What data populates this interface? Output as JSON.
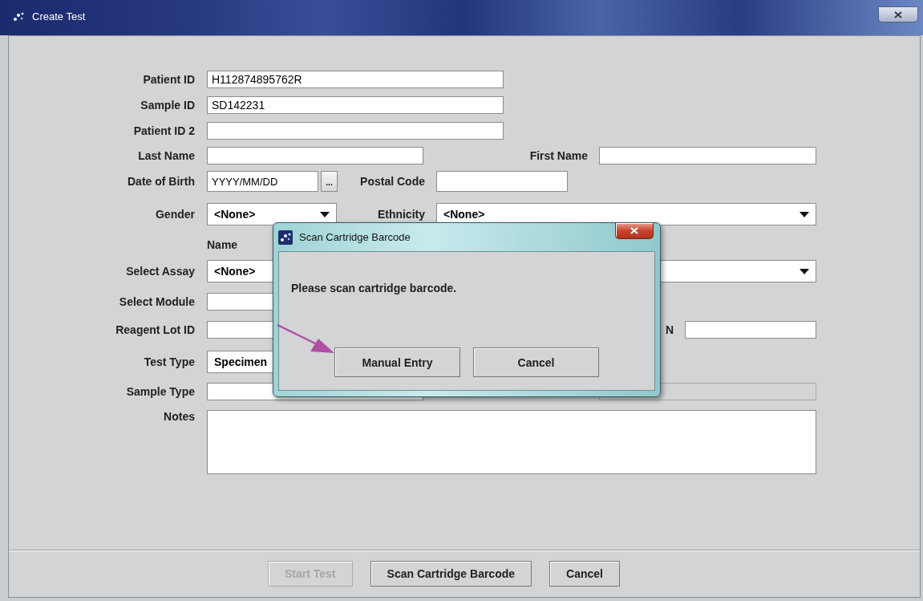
{
  "window": {
    "title": "Create Test"
  },
  "form": {
    "rows": [
      {
        "label": "Patient ID",
        "fields": [
          {
            "kind": "text",
            "value": "H112874895762R",
            "disabled": false
          }
        ]
      },
      {
        "label": "Sample ID",
        "fields": [
          {
            "kind": "text",
            "value": "SD142231",
            "disabled": false
          }
        ]
      },
      {
        "label": "Patient ID 2",
        "fields": [
          {
            "kind": "text",
            "disabled": false
          }
        ]
      },
      {
        "label": "Last Name",
        "fields": [
          {
            "kind": "text",
            "disabled": false
          },
          {
            "kind": "label",
            "text": "First Name"
          },
          {
            "kind": "text",
            "disabled": false
          }
        ]
      },
      {
        "label": "Date of Birth",
        "fields": [
          {
            "kind": "text",
            "value": "YYYY/MM/DD",
            "disabled": false
          },
          {
            "kind": "button",
            "text": "..."
          },
          {
            "kind": "label",
            "text": "Postal Code"
          },
          {
            "kind": "text",
            "disabled": false
          }
        ]
      },
      {
        "label": "Gender",
        "fields": [
          {
            "kind": "combo",
            "value": "<None>",
            "disabled": false
          },
          {
            "kind": "label",
            "text": "Ethnicity"
          },
          {
            "kind": "combo",
            "value": "<None>",
            "disabled": false
          }
        ]
      },
      {
        "label": "",
        "fields": [
          {
            "kind": "heading",
            "text": "Name"
          }
        ]
      },
      {
        "label": "Select Assay",
        "fields": [
          {
            "kind": "combo",
            "value": "<None>",
            "disabled": false
          }
        ]
      },
      {
        "label": "Select Module",
        "fields": [
          {
            "kind": "text",
            "disabled": false
          }
        ]
      },
      {
        "label": "Reagent Lot ID",
        "fields": [
          {
            "kind": "text",
            "disabled": false
          },
          {
            "kind": "label",
            "text": "N"
          },
          {
            "kind": "text",
            "disabled": false
          }
        ]
      },
      {
        "label": "Test Type",
        "fields": [
          {
            "kind": "combo",
            "value": "Specimen",
            "disabled": false
          }
        ]
      },
      {
        "label": "Sample Type",
        "fields": [
          {
            "kind": "text",
            "disabled": false
          },
          {
            "kind": "text",
            "disabled": true
          }
        ]
      },
      {
        "label": "Notes",
        "fields": [
          {
            "kind": "textarea",
            "disabled": false
          }
        ]
      }
    ]
  },
  "buttons": [
    {
      "label": "Start Test",
      "disabled": true
    },
    {
      "label": "Scan Cartridge Barcode",
      "disabled": false
    },
    {
      "label": "Cancel",
      "disabled": false
    }
  ],
  "dialog": {
    "title": "Scan Cartridge Barcode",
    "message": "Please scan cartridge barcode.",
    "buttons": [
      {
        "label": "Manual Entry"
      },
      {
        "label": "Cancel"
      }
    ]
  }
}
